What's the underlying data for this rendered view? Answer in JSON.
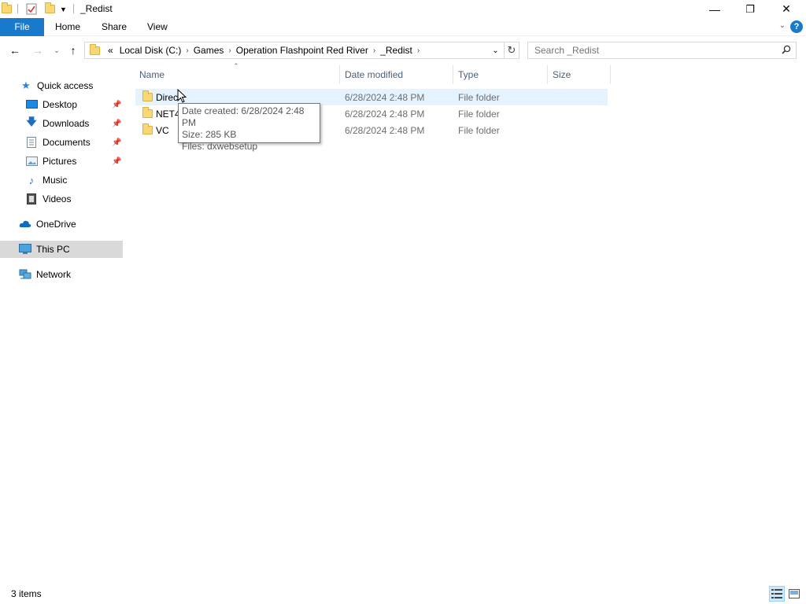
{
  "window": {
    "title": "_Redist",
    "minimize_glyph": "—",
    "restore_glyph": "❐",
    "close_glyph": "✕"
  },
  "ribbon": {
    "tabs": [
      "File",
      "Home",
      "Share",
      "View"
    ],
    "help_glyph": "?",
    "accent_color": "#1979ca"
  },
  "address_bar": {
    "overflow": "«",
    "breadcrumbs": [
      "Local Disk (C:)",
      "Games",
      "Operation Flashpoint Red River",
      "_Redist"
    ]
  },
  "search": {
    "placeholder": "Search _Redist"
  },
  "nav_pane": {
    "items": [
      {
        "label": "Quick access",
        "icon": "star-icon"
      },
      {
        "label": "Desktop",
        "icon": "desktop-icon",
        "pinned": true
      },
      {
        "label": "Downloads",
        "icon": "download-arrow-icon",
        "pinned": true
      },
      {
        "label": "Documents",
        "icon": "documents-icon",
        "pinned": true
      },
      {
        "label": "Pictures",
        "icon": "pictures-icon",
        "pinned": true
      },
      {
        "label": "Music",
        "icon": "music-note-icon"
      },
      {
        "label": "Videos",
        "icon": "film-icon"
      },
      {
        "label": "OneDrive",
        "icon": "cloud-icon"
      },
      {
        "label": "This PC",
        "icon": "computer-icon",
        "selected": true
      },
      {
        "label": "Network",
        "icon": "network-icon"
      }
    ]
  },
  "columns": [
    "Name",
    "Date modified",
    "Type",
    "Size"
  ],
  "files": [
    {
      "name": "DirectX",
      "visible_name": "Direc",
      "date": "6/28/2024 2:48 PM",
      "type": "File folder"
    },
    {
      "name": "NET4",
      "visible_name": "NET4",
      "date": "6/28/2024 2:48 PM",
      "type": "File folder"
    },
    {
      "name": "VC",
      "visible_name": "VC",
      "date": "6/28/2024 2:48 PM",
      "type": "File folder"
    }
  ],
  "tooltip": {
    "line1": "Date created: 6/28/2024 2:48 PM",
    "line2": "Size: 285 KB",
    "line3": "Files: dxwebsetup"
  },
  "status": {
    "items_count": "3 items"
  }
}
